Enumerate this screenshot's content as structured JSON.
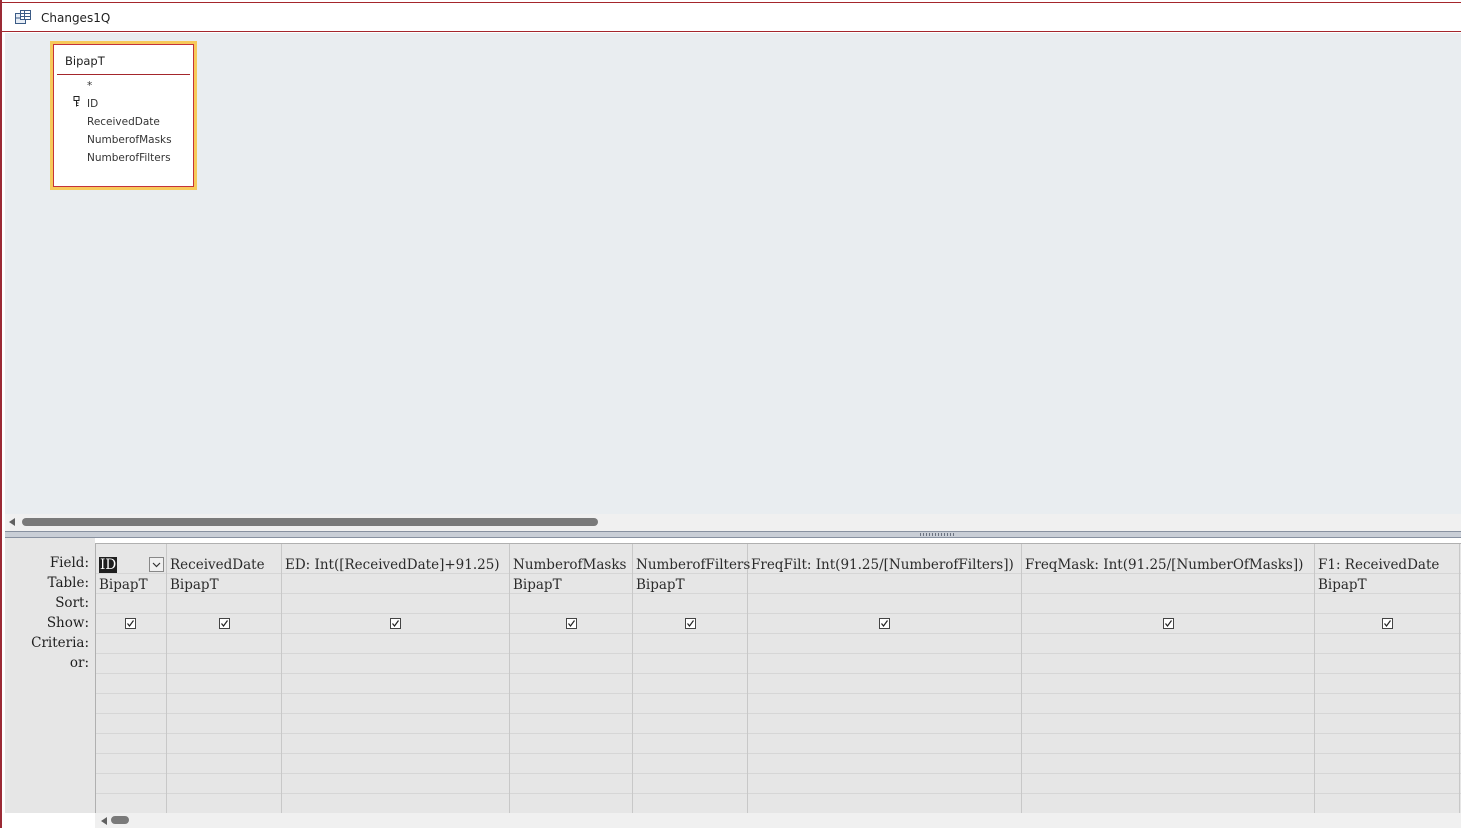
{
  "tab": {
    "title": "Changes1Q",
    "icon": "query-icon"
  },
  "table_box": {
    "title": "BipapT",
    "fields": [
      "*",
      "ID",
      "ReceivedDate",
      "NumberofMasks",
      "NumberofFilters"
    ],
    "primary_key_field": "ID"
  },
  "grid": {
    "row_labels": [
      "Field:",
      "Table:",
      "Sort:",
      "Show:",
      "Criteria:",
      "or:"
    ],
    "columns": [
      {
        "field": "ID",
        "table": "BipapT",
        "show": true,
        "selected": true
      },
      {
        "field": "ReceivedDate",
        "table": "BipapT",
        "show": true
      },
      {
        "field": "ED: Int([ReceivedDate]+91.25)",
        "table": "",
        "show": true
      },
      {
        "field": "NumberofMasks",
        "table": "BipapT",
        "show": true
      },
      {
        "field": "NumberofFilters",
        "table": "BipapT",
        "show": true
      },
      {
        "field": "FreqFilt: Int(91.25/[NumberofFilters])",
        "table": "",
        "show": true
      },
      {
        "field": "FreqMask: Int(91.25/[NumberOfMasks])",
        "table": "",
        "show": true
      },
      {
        "field": "F1: ReceivedDate",
        "table": "BipapT",
        "show": true
      }
    ]
  },
  "colors": {
    "accent_border": "#a4262c",
    "selected_table_outline": "#f7c95a",
    "canvas_bg": "#e9edf0",
    "grid_bg": "#e6e6e6"
  }
}
